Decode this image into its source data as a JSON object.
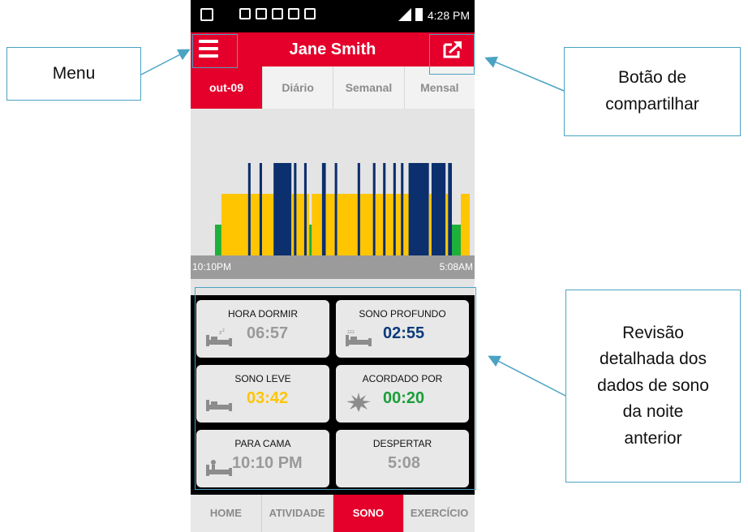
{
  "status_bar": {
    "time": "4:28 PM"
  },
  "header": {
    "title": "Jane Smith"
  },
  "tabs": [
    {
      "label": "out-09",
      "active": true
    },
    {
      "label": "Diário",
      "active": false
    },
    {
      "label": "Semanal",
      "active": false
    },
    {
      "label": "Mensal",
      "active": false
    }
  ],
  "chart_data": {
    "type": "bar",
    "x_start_label": "10:10PM",
    "x_end_label": "5:08AM",
    "colors": {
      "awake": "#1db03b",
      "light": "#ffc500",
      "deep": "#0c2f6e"
    },
    "segments": [
      {
        "start": 0.0,
        "end": 0.025,
        "level": "awake"
      },
      {
        "start": 0.025,
        "end": 0.13,
        "level": "light"
      },
      {
        "start": 0.13,
        "end": 0.14,
        "level": "deep"
      },
      {
        "start": 0.14,
        "end": 0.175,
        "level": "light"
      },
      {
        "start": 0.175,
        "end": 0.185,
        "level": "deep"
      },
      {
        "start": 0.185,
        "end": 0.23,
        "level": "light"
      },
      {
        "start": 0.23,
        "end": 0.3,
        "level": "deep"
      },
      {
        "start": 0.3,
        "end": 0.31,
        "level": "light"
      },
      {
        "start": 0.31,
        "end": 0.32,
        "level": "deep"
      },
      {
        "start": 0.32,
        "end": 0.35,
        "level": "light"
      },
      {
        "start": 0.35,
        "end": 0.36,
        "level": "deep"
      },
      {
        "start": 0.36,
        "end": 0.37,
        "level": "light"
      },
      {
        "start": 0.37,
        "end": 0.38,
        "level": "awake"
      },
      {
        "start": 0.38,
        "end": 0.42,
        "level": "light"
      },
      {
        "start": 0.42,
        "end": 0.435,
        "level": "deep"
      },
      {
        "start": 0.435,
        "end": 0.47,
        "level": "light"
      },
      {
        "start": 0.47,
        "end": 0.48,
        "level": "deep"
      },
      {
        "start": 0.48,
        "end": 0.56,
        "level": "light"
      },
      {
        "start": 0.56,
        "end": 0.57,
        "level": "deep"
      },
      {
        "start": 0.57,
        "end": 0.62,
        "level": "light"
      },
      {
        "start": 0.62,
        "end": 0.63,
        "level": "deep"
      },
      {
        "start": 0.63,
        "end": 0.66,
        "level": "light"
      },
      {
        "start": 0.66,
        "end": 0.67,
        "level": "deep"
      },
      {
        "start": 0.67,
        "end": 0.7,
        "level": "light"
      },
      {
        "start": 0.7,
        "end": 0.71,
        "level": "deep"
      },
      {
        "start": 0.71,
        "end": 0.73,
        "level": "light"
      },
      {
        "start": 0.73,
        "end": 0.74,
        "level": "deep"
      },
      {
        "start": 0.74,
        "end": 0.76,
        "level": "light"
      },
      {
        "start": 0.76,
        "end": 0.84,
        "level": "deep"
      },
      {
        "start": 0.84,
        "end": 0.85,
        "level": "light"
      },
      {
        "start": 0.85,
        "end": 0.905,
        "level": "deep"
      },
      {
        "start": 0.905,
        "end": 0.915,
        "level": "light"
      },
      {
        "start": 0.915,
        "end": 0.93,
        "level": "deep"
      },
      {
        "start": 0.93,
        "end": 0.965,
        "level": "awake"
      },
      {
        "start": 0.965,
        "end": 1.0,
        "level": "light"
      }
    ]
  },
  "stats": [
    {
      "title": "HORA DORMIR",
      "value": "06:57",
      "color": "#9a9a9a",
      "icon": "bed-sleep-icon"
    },
    {
      "title": "SONO PROFUNDO",
      "value": "02:55",
      "color": "#0c3a7a",
      "icon": "bed-sleep-icon"
    },
    {
      "title": "SONO LEVE",
      "value": "03:42",
      "color": "#ffc500",
      "icon": "bed-icon"
    },
    {
      "title": "ACORDADO POR",
      "value": "00:20",
      "color": "#1a9e3a",
      "icon": "starburst-icon"
    },
    {
      "title": "PARA CAMA",
      "value": "10:10 PM",
      "color": "#9a9a9a",
      "icon": "bed-person-icon"
    },
    {
      "title": "DESPERTAR",
      "value": "5:08",
      "color": "#9a9a9a",
      "icon": ""
    }
  ],
  "nav": [
    {
      "label": "HOME",
      "active": false
    },
    {
      "label": "ATIVIDADE",
      "active": false
    },
    {
      "label": "SONO",
      "active": true
    },
    {
      "label": "EXERCÍCIO",
      "active": false
    }
  ],
  "callouts": {
    "menu": "Menu",
    "share_l1": "Botão de",
    "share_l2": "compartilhar",
    "review_l1": "Revisão",
    "review_l2": "detalhada dos",
    "review_l3": "dados de sono",
    "review_l4": "da noite",
    "review_l5": "anterior"
  },
  "accent_color": "#e4002b",
  "annotation_color": "#4aa3c3"
}
